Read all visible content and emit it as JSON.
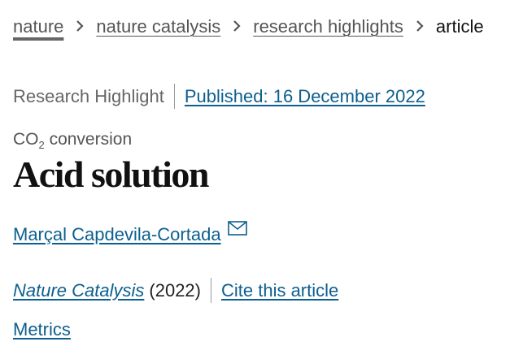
{
  "breadcrumb": {
    "items": [
      "nature",
      "nature catalysis",
      "research highlights"
    ],
    "current": "article",
    "separator_icon": "chevron-right-icon"
  },
  "meta": {
    "article_type": "Research Highlight",
    "published": "Published: 16 December 2022"
  },
  "subject": {
    "prefix": "CO",
    "subscript": "2",
    "suffix": " conversion"
  },
  "title": "Acid solution",
  "author": {
    "name": "Marçal Capdevila-Cortada",
    "contact_icon": "mail-icon"
  },
  "journal": {
    "name": "Nature Catalysis",
    "year": "(2022)",
    "cite_label": "Cite this article"
  },
  "metrics_label": "Metrics",
  "colors": {
    "link": "#0c5f8f",
    "muted": "#666666",
    "text": "#222222"
  }
}
